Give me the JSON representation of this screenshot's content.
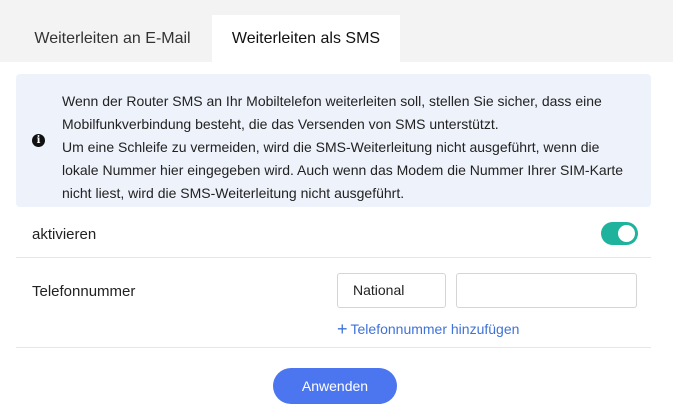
{
  "tabs": [
    {
      "label": "Weiterleiten an E-Mail",
      "active": false
    },
    {
      "label": "Weiterleiten als SMS",
      "active": true
    }
  ],
  "info": {
    "icon": "info-icon",
    "lines": [
      "Wenn der Router SMS an Ihr Mobiltelefon weiterleiten soll, stellen Sie sicher, dass eine",
      "Mobilfunkverbindung besteht, die das Versenden von SMS unterstützt.",
      "Um eine Schleife zu vermeiden, wird die SMS-Weiterleitung nicht ausgeführt, wenn die",
      "lokale Nummer hier eingegeben wird. Auch wenn das Modem die Nummer Ihrer SIM-Karte",
      "nicht liest, wird die SMS-Weiterleitung nicht ausgeführt."
    ]
  },
  "activate": {
    "label": "aktivieren",
    "enabled": true,
    "toggle_color": "#1fb29d"
  },
  "phone": {
    "label": "Telefonnummer",
    "format_selected": "National",
    "value": "",
    "placeholder": ""
  },
  "add_phone": {
    "icon": "plus-icon",
    "label": "Telefonnummer hinzufügen",
    "color": "#3f72d9"
  },
  "apply": {
    "label": "Anwenden",
    "color": "#4b76f0"
  }
}
